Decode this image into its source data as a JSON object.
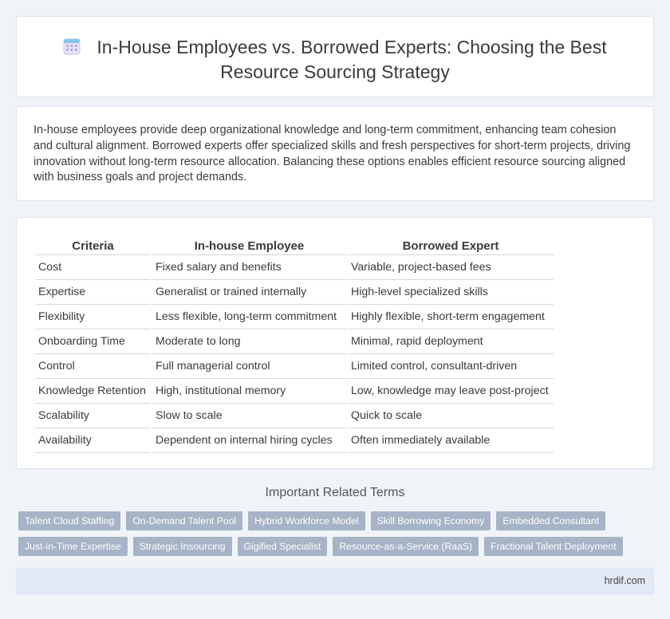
{
  "header": {
    "title_line1": "In-House Employees vs. Borrowed Experts: Choosing the Best",
    "title_line2": "Resource Sourcing Strategy",
    "icon": "calendar-icon"
  },
  "intro": {
    "text": "In-house employees provide deep organizational knowledge and long-term commitment, enhancing team cohesion and cultural alignment. Borrowed experts offer specialized skills and fresh perspectives for short-term projects, driving innovation without long-term resource allocation. Balancing these options enables efficient resource sourcing aligned with business goals and project demands."
  },
  "table": {
    "headers": [
      "Criteria",
      "In-house Employee",
      "Borrowed Expert"
    ],
    "rows": [
      [
        "Cost",
        "Fixed salary and benefits",
        "Variable, project-based fees"
      ],
      [
        "Expertise",
        "Generalist or trained internally",
        "High-level specialized skills"
      ],
      [
        "Flexibility",
        "Less flexible, long-term commitment",
        "Highly flexible, short-term engagement"
      ],
      [
        "Onboarding Time",
        "Moderate to long",
        "Minimal, rapid deployment"
      ],
      [
        "Control",
        "Full managerial control",
        "Limited control, consultant-driven"
      ],
      [
        "Knowledge Retention",
        "High, institutional memory",
        "Low, knowledge may leave post-project"
      ],
      [
        "Scalability",
        "Slow to scale",
        "Quick to scale"
      ],
      [
        "Availability",
        "Dependent on internal hiring cycles",
        "Often immediately available"
      ]
    ]
  },
  "related": {
    "title": "Important Related Terms",
    "rows": [
      [
        "Talent Cloud Staffing",
        "On-Demand Talent Pool",
        "Hybrid Workforce Model",
        "Skill Borrowing Economy",
        "Embedded Consultant"
      ],
      [
        "Just-in-Time Expertise",
        "Strategic Insourcing",
        "Gigified Specialist",
        "Resource-as-a-Service (RaaS)",
        "Fractional Talent Deployment"
      ]
    ]
  },
  "footer": {
    "site": "hrdif.com"
  },
  "colors": {
    "tag_bg": "#a7b3c6",
    "footer_bg": "#e3e9f4",
    "page_bg": "#f0f3f8"
  }
}
